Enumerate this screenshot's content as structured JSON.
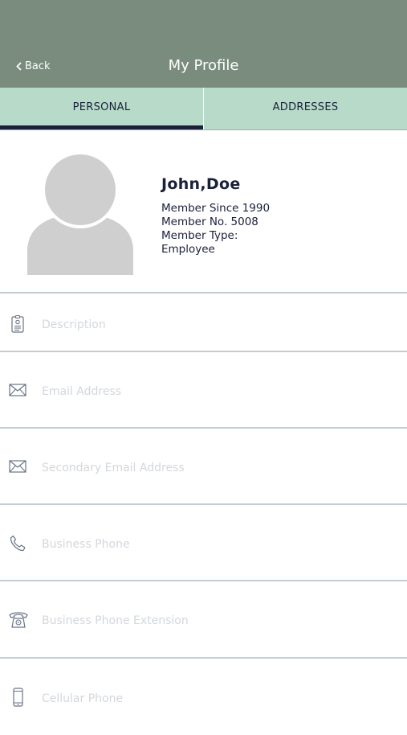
{
  "header": {
    "back_label": "Back",
    "title": "My Profile"
  },
  "tabs": [
    {
      "label": "PERSONAL",
      "active": true
    },
    {
      "label": "ADDRESSES",
      "active": false
    }
  ],
  "profile": {
    "name": "John,Doe",
    "member_since": "Member Since 1990",
    "member_no": "Member No. 5008",
    "member_type_label": "Member Type:",
    "member_type_value": "Employee"
  },
  "fields": [
    {
      "icon": "id-badge-icon",
      "placeholder": "Description"
    },
    {
      "icon": "envelope-icon",
      "placeholder": "Email Address"
    },
    {
      "icon": "envelope-icon",
      "placeholder": "Secondary Email Address"
    },
    {
      "icon": "phone-icon",
      "placeholder": "Business Phone"
    },
    {
      "icon": "desk-phone-icon",
      "placeholder": "Business Phone Extension"
    },
    {
      "icon": "mobile-phone-icon",
      "placeholder": "Cellular Phone"
    }
  ],
  "colors": {
    "header_bg": "#7a8c7e",
    "tab_bg": "#b7dbc8",
    "text_dark": "#1a1f3a",
    "placeholder": "#d3d7dc",
    "divider": "#c5ccd6"
  }
}
